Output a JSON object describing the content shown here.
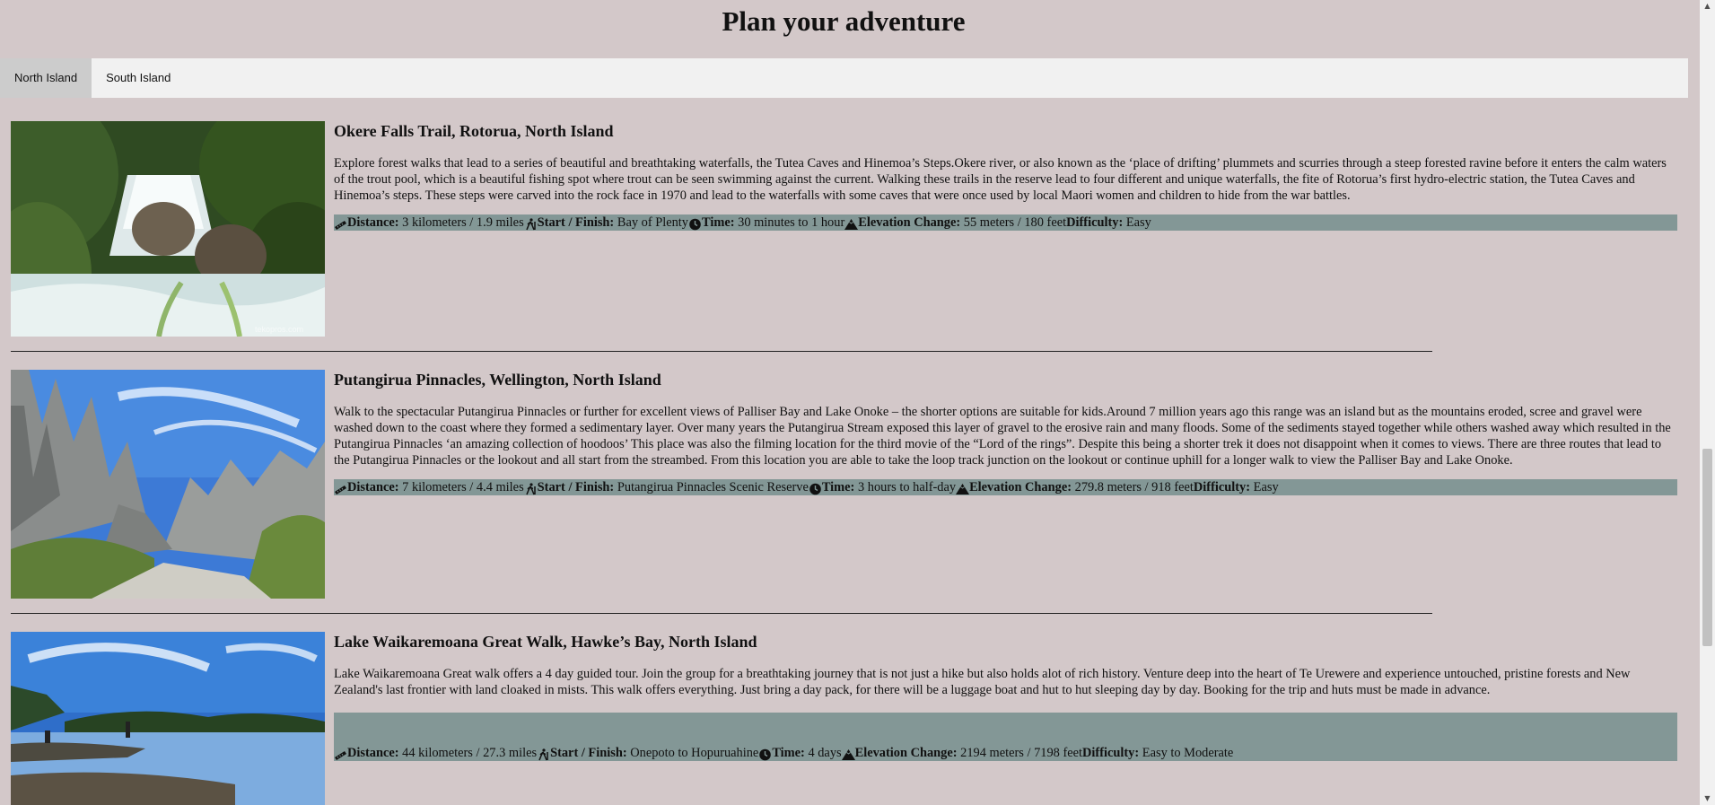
{
  "page": {
    "title": "Plan your adventure"
  },
  "tabs": [
    {
      "label": "North Island",
      "active": true
    },
    {
      "label": "South Island",
      "active": false
    }
  ],
  "labels": {
    "distance": "Distance:",
    "start_finish": "Start / Finish:",
    "time": "Time:",
    "elevation": "Elevation Change:",
    "difficulty": "Difficulty:"
  },
  "icons": {
    "distance": "ruler-icon",
    "start_finish": "hiker-icon",
    "time": "clock-icon",
    "elevation": "mountain-icon"
  },
  "colors": {
    "background": "#d3c8c9",
    "stats_bar": "#839796",
    "active_tab": "#cccccc"
  },
  "trails": [
    {
      "title": "Okere Falls Trail, Rotorua, North Island",
      "description": "Explore forest walks that lead to a series of beautiful and breathtaking waterfalls, the Tutea Caves and Hinemoa’s Steps.Okere river, or also known as the ‘place of drifting’ plummets and scurries through a steep forested ravine before it enters the calm waters of the trout pool, which is a beautiful fishing spot where trout can be seen swimming against the current. Walking these trails in the reserve lead to four different and unique waterfalls, the fite of Rotorua’s first hydro-electric station, the Tutea Caves and Hinemoa’s steps. These steps were carved into the rock face in 1970 and lead to the waterfalls with some caves that were once used by local Maori women and children to hide from the war battles.",
      "distance": "3 kilometers / 1.9 miles",
      "start_finish": "Bay of Plenty",
      "time": "30 minutes to 1 hour",
      "elevation": "55 meters / 180 feet",
      "difficulty": "Easy",
      "photo_caption": "tekopros.com"
    },
    {
      "title": "Putangirua Pinnacles, Wellington, North Island",
      "description": "Walk to the spectacular Putangirua Pinnacles or further for excellent views of Palliser Bay and Lake Onoke – the shorter options are suitable for kids.Around 7 million years ago this range was an island but as the mountains eroded, scree and gravel were washed down to the coast where they formed a sedimentary layer. Over many years the Putangirua Stream exposed this layer of gravel to the erosive rain and many floods. Some of the sediments stayed together while others washed away which resulted in the Putangirua Pinnacles ‘an amazing collection of hoodoos’ This place was also the filming location for the third movie of the “Lord of the rings”. Despite this being a shorter trek it does not disappoint when it comes to views. There are three routes that lead to the Putangirua Pinnacles or the lookout and all start from the streambed. From this location you are able to take the loop track junction on the lookout or continue uphill for a longer walk to view the Palliser Bay and Lake Onoke.",
      "distance": "7 kilometers / 4.4 miles",
      "start_finish": "Putangirua Pinnacles Scenic Reserve",
      "time": "3 hours to half-day",
      "elevation": "279.8 meters / 918 feet",
      "difficulty": "Easy"
    },
    {
      "title": "Lake Waikaremoana Great Walk, Hawke’s Bay, North Island",
      "description": "Lake Waikaremoana Great walk offers a 4 day guided tour. Join the group for a breathtaking journey that is not just a hike but also holds alot of rich history. Venture deep into the heart of Te Urewere and experience untouched, pristine forests and New Zealand's last frontier with land cloaked in mists. This walk offers everything. Just bring a day pack, for there will be a luggage boat and hut to hut sleeping day by day. Booking for the trip and huts must be made in advance.",
      "distance": "44 kilometers / 27.3 miles",
      "start_finish": "Onepoto to Hopuruahine",
      "time": "4 days",
      "elevation": "2194 meters / 7198 feet",
      "difficulty": "Easy to Moderate"
    }
  ]
}
